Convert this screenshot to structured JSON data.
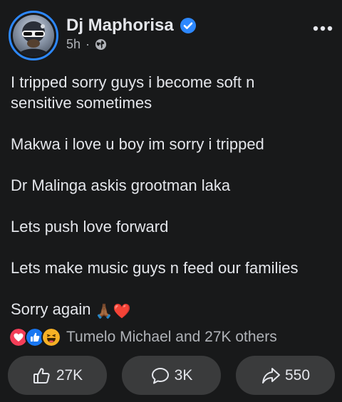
{
  "post": {
    "author": "Dj Maphorisa",
    "verified": true,
    "time": "5h",
    "separator": "·",
    "privacy_icon": "globe-icon",
    "more_icon": "more-dots-icon",
    "lines": [
      "I tripped sorry guys i become soft n",
      "sensitive sometimes",
      "",
      "Makwa i love u boy im sorry i tripped",
      "",
      "Dr Malinga askis grootman laka",
      "",
      "Lets push love forward",
      "",
      "Lets make music guys n feed our families",
      "",
      "Sorry again"
    ],
    "final_emojis": [
      "🙏🏾",
      "❤️"
    ]
  },
  "reactions": {
    "icons": [
      "love-reaction-icon",
      "like-reaction-icon",
      "haha-reaction-icon"
    ],
    "text": "Tumelo Michael and 27K others"
  },
  "actions": {
    "like_count": "27K",
    "comment_count": "3K",
    "share_count": "550"
  },
  "colors": {
    "background": "#18191a",
    "text": "#e4e6eb",
    "secondary_text": "#b0b3b8",
    "accent": "#2d88ff",
    "button_bg": "#3a3b3c",
    "love": "#f33e58",
    "like": "#1877f2",
    "haha": "#f7b125"
  }
}
